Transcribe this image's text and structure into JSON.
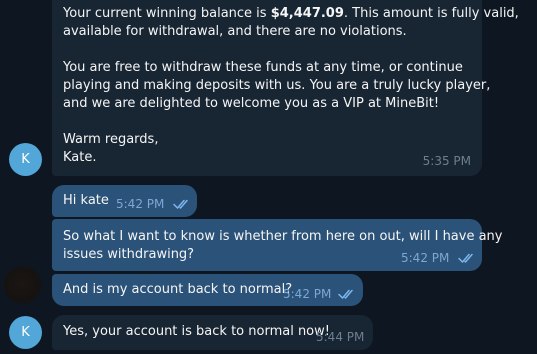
{
  "chat": {
    "messages": [
      {
        "lines_a": [
          "Your current winning balance is ",
          "$4,447.09",
          ". This amount is fully valid,"
        ],
        "lines": [
          "available for withdrawal, and there are no violations.",
          "You are free to withdraw these funds at any time, or continue",
          "playing and making deposits with us. You are a truly lucky player,",
          "and we are delighted to welcome you as a VIP at MineBit!",
          "Warm regards,",
          "Kate."
        ],
        "time": "5:35 PM",
        "avatar_letter": "K"
      },
      {
        "text": "Hi kate",
        "time": "5:42 PM",
        "status_icon": "double-check-icon"
      },
      {
        "lines": [
          "So what I want to know is whether from here on out, will I have any",
          "issues withdrawing?"
        ],
        "time": "5:42 PM",
        "status_icon": "double-check-icon"
      },
      {
        "text": "And is my account back to normal?",
        "time": "5:42 PM",
        "status_icon": "double-check-icon"
      },
      {
        "text": "Yes, your account is back to normal now!",
        "time": "5:44 PM",
        "avatar_letter": "K"
      }
    ]
  },
  "colors": {
    "background": "#0e1621",
    "incoming_bubble": "#182533",
    "outgoing_bubble": "#2b5278",
    "avatar": "#52a7d8",
    "check": "#7ab7f0"
  }
}
